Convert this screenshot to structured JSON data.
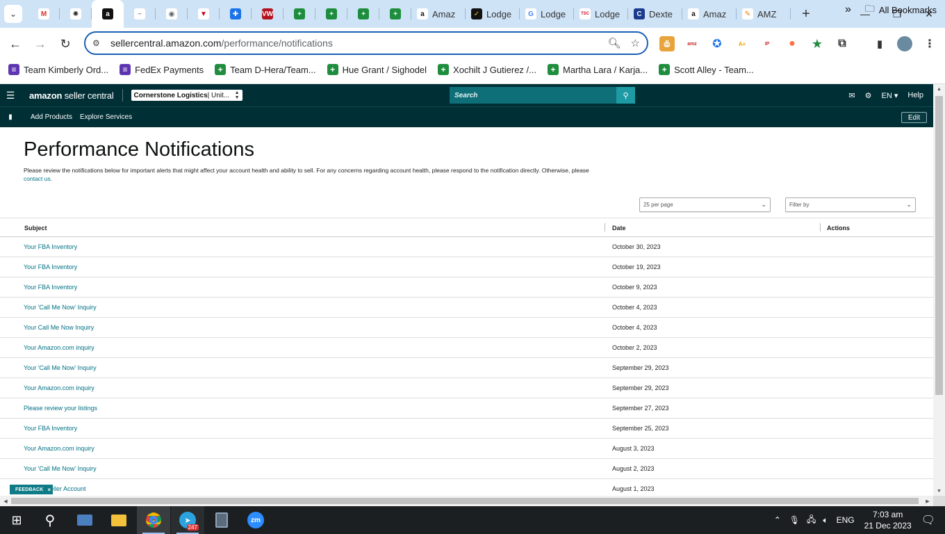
{
  "browser": {
    "tabs": [
      {
        "label": "",
        "icon": "gmail-icon",
        "color": "#ffffff",
        "glyph": "M",
        "glyph_color": "#d93025"
      },
      {
        "label": "",
        "icon": "openai-icon",
        "color": "#ffffff",
        "glyph": "✺",
        "glyph_color": "#222222"
      },
      {
        "label": "",
        "icon": "amazon-icon",
        "color": "#111111",
        "glyph": "a",
        "glyph_color": "#ffffff",
        "active": true
      },
      {
        "label": "",
        "icon": "helium-icon",
        "color": "#ffffff",
        "glyph": "~",
        "glyph_color": "#8a8f99"
      },
      {
        "label": "",
        "icon": "globe-icon",
        "color": "#ffffff",
        "glyph": "◉",
        "glyph_color": "#5f6368"
      },
      {
        "label": "",
        "icon": "red-chevron-icon",
        "color": "#ffffff",
        "glyph": "▼",
        "glyph_color": "#d0021b"
      },
      {
        "label": "",
        "icon": "blue-circle-icon",
        "color": "#1a73e8",
        "glyph": "✚",
        "glyph_color": "#ffffff"
      },
      {
        "label": "",
        "icon": "vw-icon",
        "color": "#b3121f",
        "glyph": "VW",
        "glyph_color": "#ffffff"
      },
      {
        "label": "",
        "icon": "sheets-icon",
        "color": "#1e8e3e",
        "glyph": "+",
        "glyph_color": "#ffffff"
      },
      {
        "label": "",
        "icon": "sheets-icon",
        "color": "#1e8e3e",
        "glyph": "+",
        "glyph_color": "#ffffff"
      },
      {
        "label": "",
        "icon": "sheets-icon",
        "color": "#1e8e3e",
        "glyph": "+",
        "glyph_color": "#ffffff"
      },
      {
        "label": "",
        "icon": "sheets-icon",
        "color": "#1e8e3e",
        "glyph": "+",
        "glyph_color": "#ffffff"
      },
      {
        "label": "Amaz",
        "icon": "amazon-icon",
        "color": "#ffffff",
        "glyph": "a",
        "glyph_color": "#111111"
      },
      {
        "label": "Lodge",
        "icon": "lodge-icon",
        "color": "#111111",
        "glyph": "✓",
        "glyph_color": "#f5c400"
      },
      {
        "label": "Lodge",
        "icon": "google-icon",
        "color": "#ffffff",
        "glyph": "G",
        "glyph_color": "#4285f4"
      },
      {
        "label": "Lodge",
        "icon": "tsc-icon",
        "color": "#ffffff",
        "glyph": "TSC",
        "glyph_color": "#c8102e"
      },
      {
        "label": "Dexte",
        "icon": "dexter-icon",
        "color": "#1a3a8f",
        "glyph": "C",
        "glyph_color": "#ffffff"
      },
      {
        "label": "Amaz",
        "icon": "amazon-icon",
        "color": "#ffffff",
        "glyph": "a",
        "glyph_color": "#111111"
      },
      {
        "label": "AMZ",
        "icon": "amz-icon",
        "color": "#ffffff",
        "glyph": "✎",
        "glyph_color": "#f57c00"
      }
    ],
    "url_host": "sellercentral.amazon.com",
    "url_path": "/performance/notifications",
    "bookmarks": [
      {
        "label": "Team Kimberly Ord...",
        "color": "#5e35b1",
        "glyph": "≡"
      },
      {
        "label": "FedEx Payments",
        "color": "#5e35b1",
        "glyph": "≡"
      },
      {
        "label": "Team D-Hera/Team...",
        "color": "#1e8e3e",
        "glyph": "+"
      },
      {
        "label": "Hue Grant / Sighodel",
        "color": "#1e8e3e",
        "glyph": "+"
      },
      {
        "label": "Xochilt J Gutierez /...",
        "color": "#1e8e3e",
        "glyph": "+"
      },
      {
        "label": "Martha Lara / Karja...",
        "color": "#1e8e3e",
        "glyph": "+"
      },
      {
        "label": "Scott Alley - Team...",
        "color": "#1e8e3e",
        "glyph": "+"
      }
    ],
    "bookmarks_more": "»",
    "all_bookmarks": "All Bookmarks"
  },
  "amazon": {
    "logo": "amazon",
    "logo_suffix": " seller central",
    "account_name": "Cornerstone Logistics",
    "account_region": " | Unit...",
    "search_placeholder": "Search",
    "language": "EN ▾",
    "help": "Help",
    "nav_links": [
      "Add Products",
      "Explore Services"
    ],
    "edit": "Edit"
  },
  "page": {
    "title": "Performance Notifications",
    "description": "Please review the notifications below for important alerts that might affect your account health and ability to sell. For any concerns regarding account health, please respond to the notification directly. Otherwise, please",
    "contact_link": "contact us.",
    "per_page": "25 per page",
    "filter": "Filter by",
    "columns": {
      "subject": "Subject",
      "date": "Date",
      "actions": "Actions"
    },
    "rows": [
      {
        "subject": "Your FBA Inventory",
        "date": "October 30, 2023"
      },
      {
        "subject": "Your FBA Inventory",
        "date": "October 19, 2023"
      },
      {
        "subject": "Your FBA Inventory",
        "date": "October 9, 2023"
      },
      {
        "subject": "Your 'Call Me Now' Inquiry",
        "date": "October 4, 2023"
      },
      {
        "subject": "Your Call Me Now Inquiry",
        "date": "October 4, 2023"
      },
      {
        "subject": "Your Amazon.com inquiry",
        "date": "October 2, 2023"
      },
      {
        "subject": "Your 'Call Me Now' Inquiry",
        "date": "September 29, 2023"
      },
      {
        "subject": "Your Amazon.com inquiry",
        "date": "September 29, 2023"
      },
      {
        "subject": "Please review your listings",
        "date": "September 27, 2023"
      },
      {
        "subject": "Your FBA Inventory",
        "date": "September 25, 2023"
      },
      {
        "subject": "Your Amazon.com inquiry",
        "date": "August 3, 2023"
      },
      {
        "subject": "Your 'Call Me Now' Inquiry",
        "date": "August 2, 2023"
      },
      {
        "subject": "on.com Seller Account",
        "date": "August 1, 2023"
      }
    ],
    "feedback": "FEEDBACK",
    "feedback_close": "×"
  },
  "taskbar": {
    "telegram_badge": "247",
    "language": "ENG",
    "time": "7:03 am",
    "date": "21 Dec 2023"
  },
  "colors": {
    "amazon_header": "#002f36",
    "link": "#007185",
    "omnibox_border": "#1a5fb4",
    "tabstrip": "#cfe3f7"
  }
}
